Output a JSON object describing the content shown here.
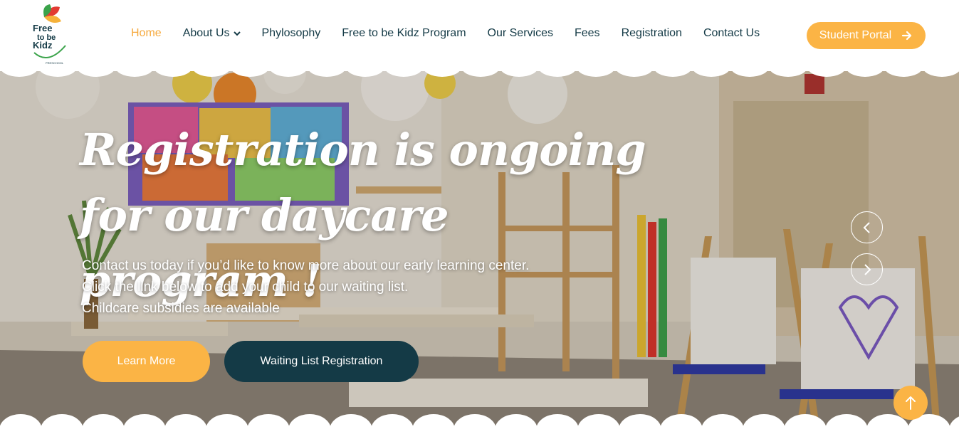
{
  "brand": {
    "logo_lines": [
      "Free",
      "to be",
      "Kidz"
    ],
    "logo_sub": "PRESCHOOL"
  },
  "nav": {
    "items": [
      {
        "label": "Home",
        "active": true
      },
      {
        "label": "About Us",
        "dropdown": true
      },
      {
        "label": "Phylosophy"
      },
      {
        "label": "Free to be Kidz Program"
      },
      {
        "label": "Our Services"
      },
      {
        "label": "Fees"
      },
      {
        "label": "Registration"
      },
      {
        "label": "Contact Us"
      }
    ],
    "portal_label": "Student Portal"
  },
  "hero": {
    "headline_line1": "Registration is ongoing",
    "headline_line2": "for our daycare program !",
    "sub_lines": [
      "Contact us today if you’d like to know more about our early learning center.",
      "Click the link below to add your child to our waiting list.",
      "Childcare subsidies are available"
    ],
    "learn_more_label": "Learn More",
    "waiting_list_label": "Waiting List Registration"
  },
  "colors": {
    "accent": "#fbb445",
    "dark": "#143a46",
    "active_nav": "#f6a93d"
  },
  "icons": [
    "chevron-down-icon",
    "arrow-right-icon",
    "chevron-left-icon",
    "chevron-right-icon",
    "arrow-up-icon"
  ]
}
